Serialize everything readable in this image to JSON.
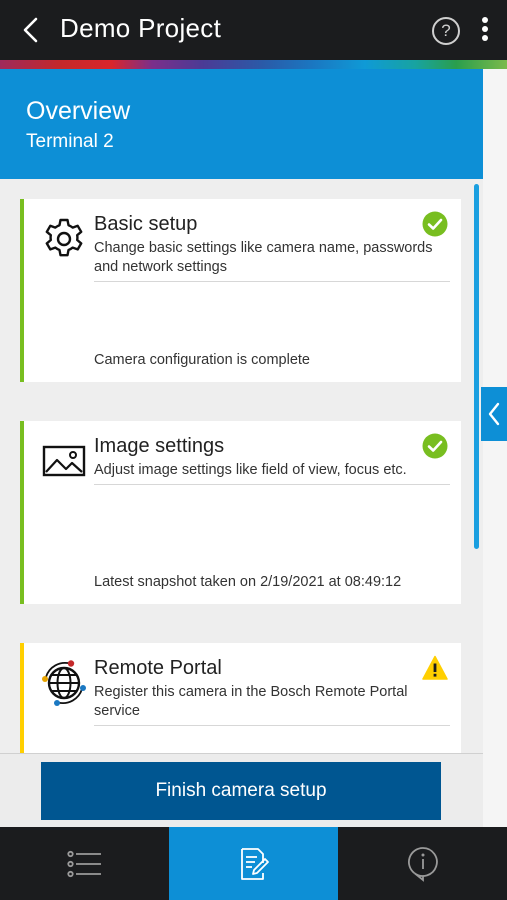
{
  "header": {
    "title": "Demo Project",
    "back_icon": "chevron-left-icon",
    "help_icon": "help-icon",
    "help_glyph": "?",
    "more_icon": "more-vertical-icon"
  },
  "overview": {
    "heading": "Overview",
    "subheading": "Terminal 2"
  },
  "cards": [
    {
      "title": "Basic setup",
      "description": "Change basic settings like camera name, passwords and network settings",
      "status": "Camera configuration is complete",
      "icon": "gear-icon",
      "badge": "check-circle-icon",
      "state_color": "#78be20"
    },
    {
      "title": "Image settings",
      "description": "Adjust image settings like field of view, focus etc.",
      "status": "Latest snapshot taken on 2/19/2021 at 08:49:12",
      "icon": "image-icon",
      "badge": "check-circle-icon",
      "state_color": "#78be20"
    },
    {
      "title": "Remote Portal",
      "description": "Register this camera in the Bosch Remote Portal service",
      "status": "",
      "icon": "globe-network-icon",
      "badge": "warning-icon",
      "state_color": "#ffcf00"
    }
  ],
  "finish_button": {
    "label": "Finish camera setup"
  },
  "bottom_nav": [
    {
      "name": "list",
      "icon": "list-icon",
      "active": false
    },
    {
      "name": "edit",
      "icon": "edit-document-icon",
      "active": true
    },
    {
      "name": "info",
      "icon": "info-icon",
      "active": false
    }
  ],
  "colors": {
    "primary_blue": "#0d8fd6",
    "dark_blue": "#005691",
    "success": "#78be20",
    "warning": "#ffcf00",
    "header_bg": "#1b1c1e"
  }
}
